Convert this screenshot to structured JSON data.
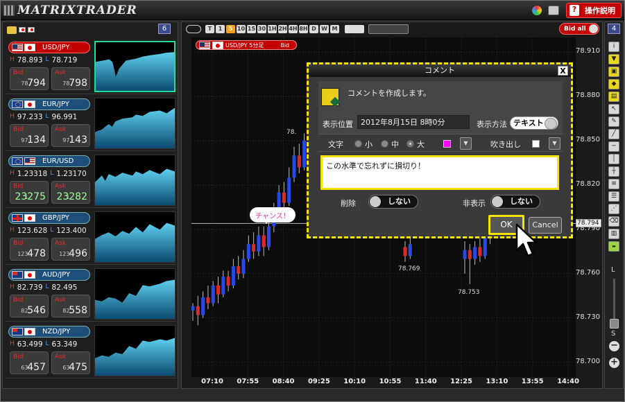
{
  "app": {
    "logo_text": "MATRIXTRADER",
    "help_label": "操作説明",
    "help_glyph": "?"
  },
  "left_panel": {
    "count": "6"
  },
  "pairs": [
    {
      "symbol": "USD/JPY",
      "flags": [
        "us",
        "jp"
      ],
      "active": true,
      "high": "78.893",
      "low": "78.719",
      "bid_prefix": "78.",
      "bid_big": "794",
      "ask_prefix": "78.",
      "ask_big": "798"
    },
    {
      "symbol": "EUR/JPY",
      "flags": [
        "eu",
        "jp"
      ],
      "active": false,
      "high": "97.233",
      "low": "96.991",
      "bid_prefix": "97.",
      "bid_big": "134",
      "ask_prefix": "97.",
      "ask_big": "143"
    },
    {
      "symbol": "EUR/USD",
      "flags": [
        "eu",
        "us"
      ],
      "active": false,
      "high": "1.23318",
      "low": "1.23170",
      "bid_prefix": "1.",
      "bid_big": "23275",
      "ask_prefix": "1.",
      "ask_big": "23282",
      "green": true
    },
    {
      "symbol": "GBP/JPY",
      "flags": [
        "gb",
        "jp"
      ],
      "active": false,
      "high": "123.628",
      "low": "123.400",
      "bid_prefix": "123.",
      "bid_big": "478",
      "ask_prefix": "123.",
      "ask_big": "496"
    },
    {
      "symbol": "AUD/JPY",
      "flags": [
        "au",
        "jp"
      ],
      "active": false,
      "high": "82.739",
      "low": "82.495",
      "bid_prefix": "82.",
      "bid_big": "546",
      "ask_prefix": "82.",
      "ask_big": "558"
    },
    {
      "symbol": "NZD/JPY",
      "flags": [
        "nz",
        "jp"
      ],
      "active": false,
      "high": "63.499",
      "low": "63.349",
      "bid_prefix": "63.",
      "bid_big": "457",
      "ask_prefix": "63.",
      "ask_big": "475"
    }
  ],
  "labels": {
    "high": "H",
    "low": "L",
    "bid": "Bid",
    "ask": "Ask"
  },
  "toolbar": {
    "timeframes": [
      "T",
      "1",
      "5",
      "10",
      "15",
      "30",
      "1H",
      "2H",
      "4H",
      "8H",
      "D",
      "W",
      "M"
    ],
    "selected": "5",
    "bid_all": "Bid all",
    "tools_count": "4"
  },
  "chart": {
    "pair_badge": "USD/JPY 5分足",
    "pair_badge_side": "Bid",
    "current_price": "78.794",
    "annotation": "チャンス！"
  },
  "chart_data": {
    "type": "candlestick",
    "y_ticks": [
      "78.910",
      "78.880",
      "78.850",
      "78.820",
      "78.790",
      "78.760",
      "78.730",
      "78.700"
    ],
    "x_ticks": [
      "07:10",
      "07:55",
      "08:40",
      "09:25",
      "10:10",
      "10:55",
      "11:40",
      "12:25",
      "13:10",
      "13:55",
      "14:40"
    ],
    "labels": [
      {
        "text": "78.",
        "value": 78.854
      },
      {
        "text": "78.769",
        "value": 78.769
      },
      {
        "text": "78.753",
        "value": 78.753
      }
    ],
    "ylim": [
      78.69,
      78.92
    ],
    "candles": [
      [
        78.735,
        78.738,
        78.728,
        78.74
      ],
      [
        78.738,
        78.732,
        78.725,
        78.745
      ],
      [
        78.732,
        78.744,
        78.73,
        78.748
      ],
      [
        78.744,
        78.74,
        78.736,
        78.752
      ],
      [
        78.74,
        78.752,
        78.738,
        78.755
      ],
      [
        78.752,
        78.746,
        78.74,
        78.758
      ],
      [
        78.746,
        78.758,
        78.744,
        78.762
      ],
      [
        78.758,
        78.752,
        78.748,
        78.762
      ],
      [
        78.752,
        78.765,
        78.75,
        78.77
      ],
      [
        78.765,
        78.76,
        78.756,
        78.772
      ],
      [
        78.76,
        78.77,
        78.757,
        78.776
      ],
      [
        78.77,
        78.78,
        78.768,
        78.786
      ],
      [
        78.78,
        78.775,
        78.77,
        78.788
      ],
      [
        78.775,
        78.786,
        78.772,
        78.792
      ],
      [
        78.786,
        78.778,
        78.772,
        78.792
      ],
      [
        78.778,
        78.792,
        78.776,
        78.798
      ],
      [
        78.792,
        78.803,
        78.788,
        78.808
      ],
      [
        78.803,
        78.815,
        78.8,
        78.82
      ],
      [
        78.815,
        78.808,
        78.802,
        78.822
      ],
      [
        78.808,
        78.825,
        78.806,
        78.832
      ],
      [
        78.825,
        78.84,
        78.822,
        78.846
      ],
      [
        78.84,
        78.832,
        78.828,
        78.848
      ],
      [
        78.832,
        78.85,
        78.83,
        78.855
      ]
    ],
    "candles_right": [
      [
        78.778,
        78.772,
        78.768,
        78.782
      ],
      [
        78.772,
        78.78,
        78.77,
        78.784
      ]
    ],
    "candles_right2": [
      [
        78.77,
        78.776,
        78.76,
        78.782
      ],
      [
        78.776,
        78.77,
        78.753,
        78.78
      ],
      [
        78.77,
        78.778,
        78.766,
        78.782
      ],
      [
        78.778,
        78.772,
        78.768,
        78.784
      ],
      [
        78.772,
        78.784,
        78.77,
        78.788
      ],
      [
        78.784,
        78.79,
        78.78,
        78.794
      ]
    ]
  },
  "dialog": {
    "title": "コメント",
    "close": "X",
    "message": "コメントを作成します。",
    "position_label": "表示位置",
    "position_value": "2012年8月15日  8時0分",
    "mode_label": "表示方法",
    "mode_value": "テキスト",
    "font_label": "文字",
    "size_small": "小",
    "size_medium": "中",
    "size_large": "大",
    "selected_size": "大",
    "text_color": "#ff00ff",
    "bubble_label": "吹き出し",
    "bubble_color": "#ffffff",
    "comment_text": "この水準で忘れずに損切り！",
    "delete_label": "削除",
    "delete_value": "しない",
    "hide_label": "非表示",
    "hide_value": "しない",
    "ok_label": "OK",
    "cancel_label": "Cancel"
  },
  "zoom": {
    "large": "L",
    "small": "S",
    "minus": "−",
    "plus": "+"
  }
}
